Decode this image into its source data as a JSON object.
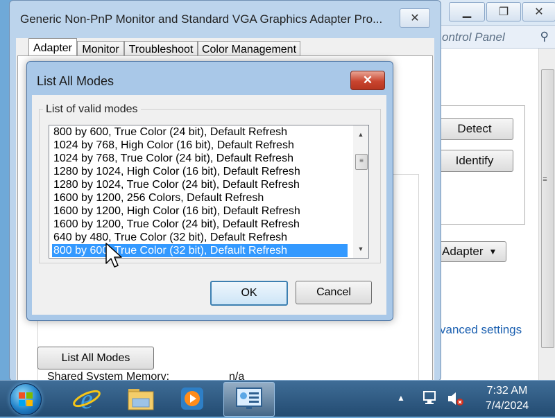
{
  "background_window": {
    "address_text": "ontrol Panel",
    "buttons": {
      "detect": "Detect",
      "identify": "Identify",
      "adapter_dropdown": "Adapter"
    },
    "advanced_link": "vanced settings"
  },
  "properties_window": {
    "title": "Generic Non-PnP Monitor and Standard VGA Graphics Adapter Pro...",
    "tabs": [
      "Adapter",
      "Monitor",
      "Troubleshoot",
      "Color Management"
    ],
    "shared_memory_label": "Shared System Memory:",
    "shared_memory_value": "n/a",
    "list_all_modes_button": "List All Modes"
  },
  "dialog": {
    "title": "List All Modes",
    "group_label": "List of valid modes",
    "modes": [
      "800 by 600, True Color (24 bit), Default Refresh",
      "1024 by 768, High Color (16 bit), Default Refresh",
      "1024 by 768, True Color (24 bit), Default Refresh",
      "1280 by 1024, High Color (16 bit), Default Refresh",
      "1280 by 1024, True Color (24 bit), Default Refresh",
      "1600 by 1200, 256 Colors, Default Refresh",
      "1600 by 1200, High Color (16 bit), Default Refresh",
      "1600 by 1200, True Color (24 bit), Default Refresh",
      "640 by 480, True Color (32 bit), Default Refresh",
      "800 by 600, True Color (32 bit), Default Refresh"
    ],
    "selected_index": 9,
    "ok_button": "OK",
    "cancel_button": "Cancel"
  },
  "taskbar": {
    "time": "7:32 AM",
    "date": "7/4/2024",
    "pinned": [
      "internet-explorer",
      "file-explorer",
      "media-player",
      "display-settings"
    ]
  },
  "colors": {
    "selection": "#3399ff",
    "close_button": "#c9452f",
    "link": "#1a5fb0"
  }
}
